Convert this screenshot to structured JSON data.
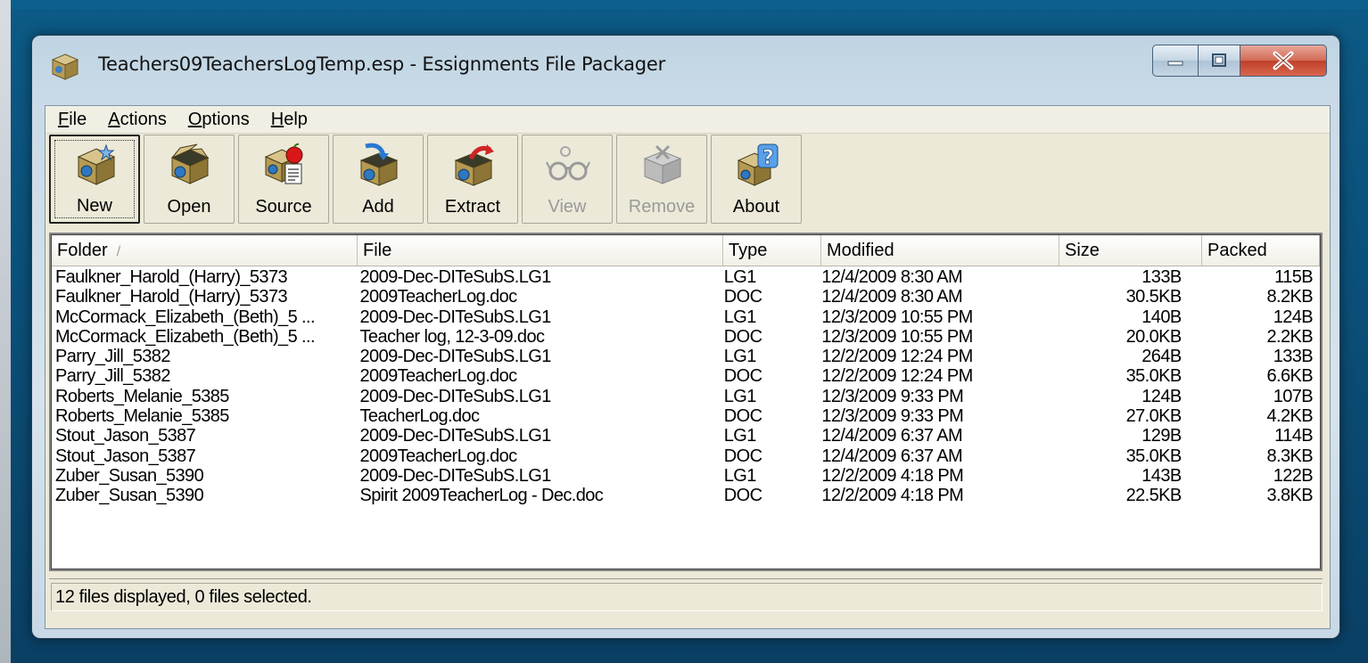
{
  "window": {
    "title": "Teachers09TeachersLogTemp.esp - Essignments File Packager"
  },
  "menu": [
    {
      "u": "F",
      "rest": "ile"
    },
    {
      "u": "A",
      "rest": "ctions"
    },
    {
      "u": "O",
      "rest": "ptions"
    },
    {
      "u": "H",
      "rest": "elp"
    }
  ],
  "toolbar": {
    "new_label": "New",
    "open_label": "Open",
    "source_label": "Source",
    "add_label": "Add",
    "extract_label": "Extract",
    "view_label": "View",
    "remove_label": "Remove",
    "about_label": "About"
  },
  "columns": {
    "folder": "Folder",
    "file": "File",
    "type": "Type",
    "modified": "Modified",
    "size": "Size",
    "packed": "Packed"
  },
  "rows": [
    {
      "folder": "Faulkner_Harold_(Harry)_5373",
      "file": "2009-Dec-DITeSubS.LG1",
      "type": "LG1",
      "modified": "12/4/2009 8:30 AM",
      "size": "133B",
      "packed": "115B"
    },
    {
      "folder": "Faulkner_Harold_(Harry)_5373",
      "file": "2009TeacherLog.doc",
      "type": "DOC",
      "modified": "12/4/2009 8:30 AM",
      "size": "30.5KB",
      "packed": "8.2KB"
    },
    {
      "folder": "McCormack_Elizabeth_(Beth)_5 ...",
      "file": "2009-Dec-DITeSubS.LG1",
      "type": "LG1",
      "modified": "12/3/2009 10:55 PM",
      "size": "140B",
      "packed": "124B"
    },
    {
      "folder": "McCormack_Elizabeth_(Beth)_5 ...",
      "file": "Teacher log, 12-3-09.doc",
      "type": "DOC",
      "modified": "12/3/2009 10:55 PM",
      "size": "20.0KB",
      "packed": "2.2KB"
    },
    {
      "folder": "Parry_Jill_5382",
      "file": "2009-Dec-DITeSubS.LG1",
      "type": "LG1",
      "modified": "12/2/2009 12:24 PM",
      "size": "264B",
      "packed": "133B"
    },
    {
      "folder": "Parry_Jill_5382",
      "file": "2009TeacherLog.doc",
      "type": "DOC",
      "modified": "12/2/2009 12:24 PM",
      "size": "35.0KB",
      "packed": "6.6KB"
    },
    {
      "folder": "Roberts_Melanie_5385",
      "file": "2009-Dec-DITeSubS.LG1",
      "type": "LG1",
      "modified": "12/3/2009 9:33 PM",
      "size": "124B",
      "packed": "107B"
    },
    {
      "folder": "Roberts_Melanie_5385",
      "file": "TeacherLog.doc",
      "type": "DOC",
      "modified": "12/3/2009 9:33 PM",
      "size": "27.0KB",
      "packed": "4.2KB"
    },
    {
      "folder": "Stout_Jason_5387",
      "file": "2009-Dec-DITeSubS.LG1",
      "type": "LG1",
      "modified": "12/4/2009 6:37 AM",
      "size": "129B",
      "packed": "114B"
    },
    {
      "folder": "Stout_Jason_5387",
      "file": "2009TeacherLog.doc",
      "type": "DOC",
      "modified": "12/4/2009 6:37 AM",
      "size": "35.0KB",
      "packed": "8.3KB"
    },
    {
      "folder": "Zuber_Susan_5390",
      "file": "2009-Dec-DITeSubS.LG1",
      "type": "LG1",
      "modified": "12/2/2009 4:18 PM",
      "size": "143B",
      "packed": "122B"
    },
    {
      "folder": "Zuber_Susan_5390",
      "file": "Spirit 2009TeacherLog - Dec.doc",
      "type": "DOC",
      "modified": "12/2/2009 4:18 PM",
      "size": "22.5KB",
      "packed": "3.8KB"
    }
  ],
  "status": {
    "text": "12 files displayed, 0 files selected."
  }
}
